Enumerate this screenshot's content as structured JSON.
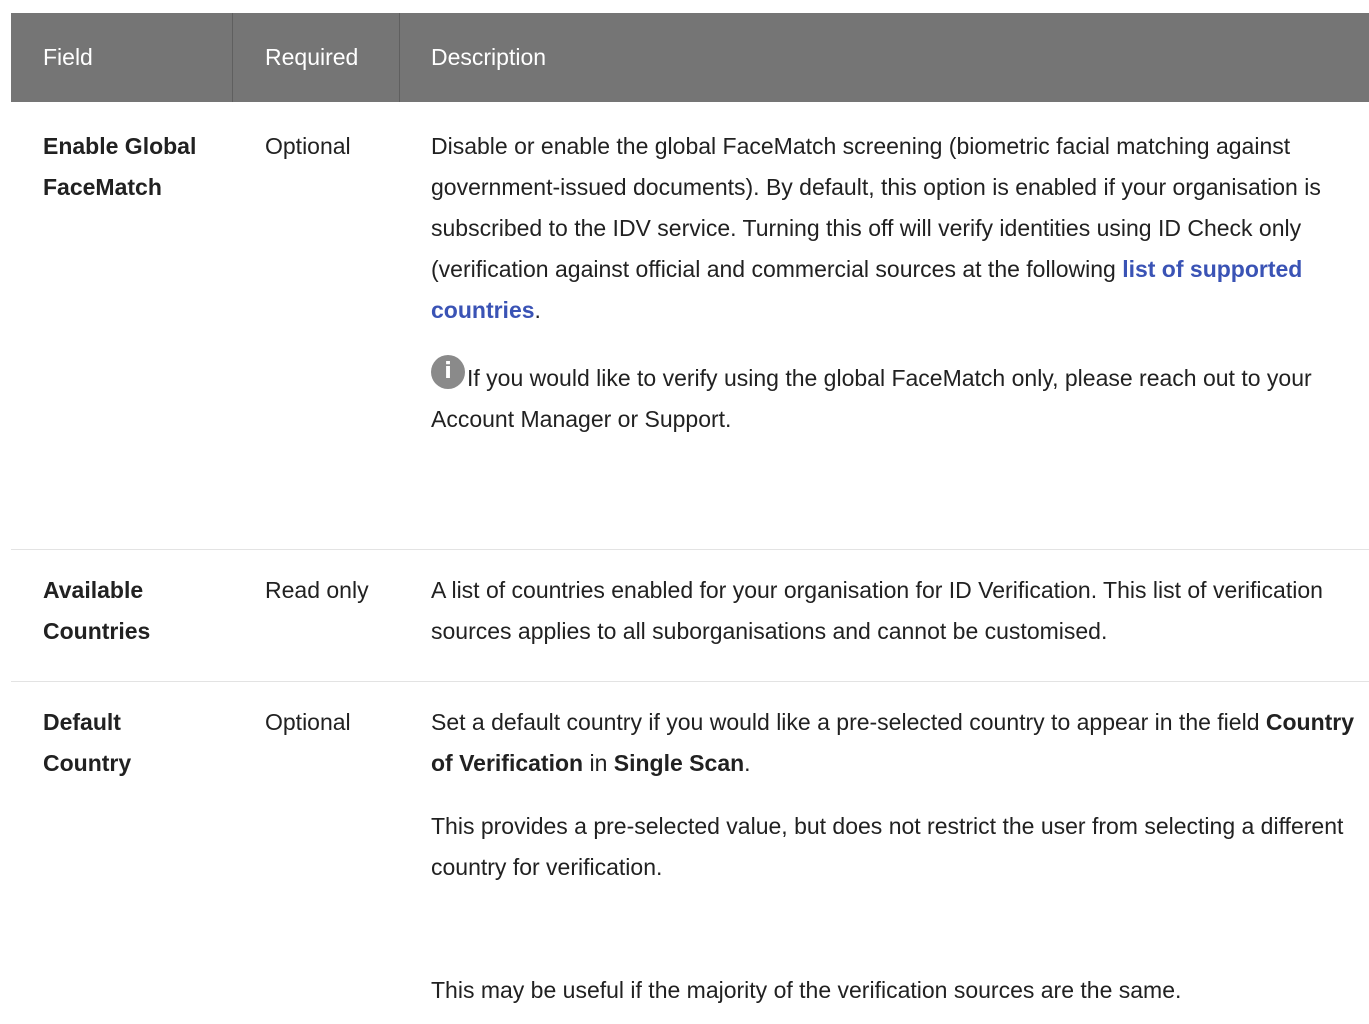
{
  "table": {
    "headers": {
      "field": "Field",
      "required": "Required",
      "description": "Description"
    },
    "rows": [
      {
        "field": "Enable Global FaceMatch",
        "required": "Optional",
        "description_before_link": "Disable or enable the global FaceMatch screening (biometric facial matching against government-issued documents). By default, this option is enabled if your organisation is subscribed to the IDV service. Turning this off will verify identities using ID Check only (verification against official and commercial sources at the following ",
        "link_text": "list of supported countries",
        "description_after_link": ".",
        "info_note": "If you would like to verify using the global FaceMatch only, please reach out to your Account Manager or Support."
      },
      {
        "field": "Available Countries",
        "required": "Read only",
        "description": "A list of countries enabled for your organisation for ID Verification. This list of verification sources applies to all suborganisations and cannot be customised."
      },
      {
        "field": "Default Country",
        "required": "Optional",
        "desc_p1_a": "Set a default country if you would like a pre-selected country to appear in the field ",
        "desc_p1_bold1": "Country of Verification",
        "desc_p1_b": " in ",
        "desc_p1_bold2": "Single Scan",
        "desc_p1_c": ".",
        "desc_p2": "This provides a pre-selected value, but does not restrict the user from selecting a different country for verification.",
        "desc_p3": "This may be useful if the majority of the verification sources are the same."
      }
    ]
  },
  "icons": {
    "info": "info-icon"
  },
  "colors": {
    "header_bg": "#757575",
    "link": "#3a53b5",
    "divider": "#e3e3e3"
  }
}
